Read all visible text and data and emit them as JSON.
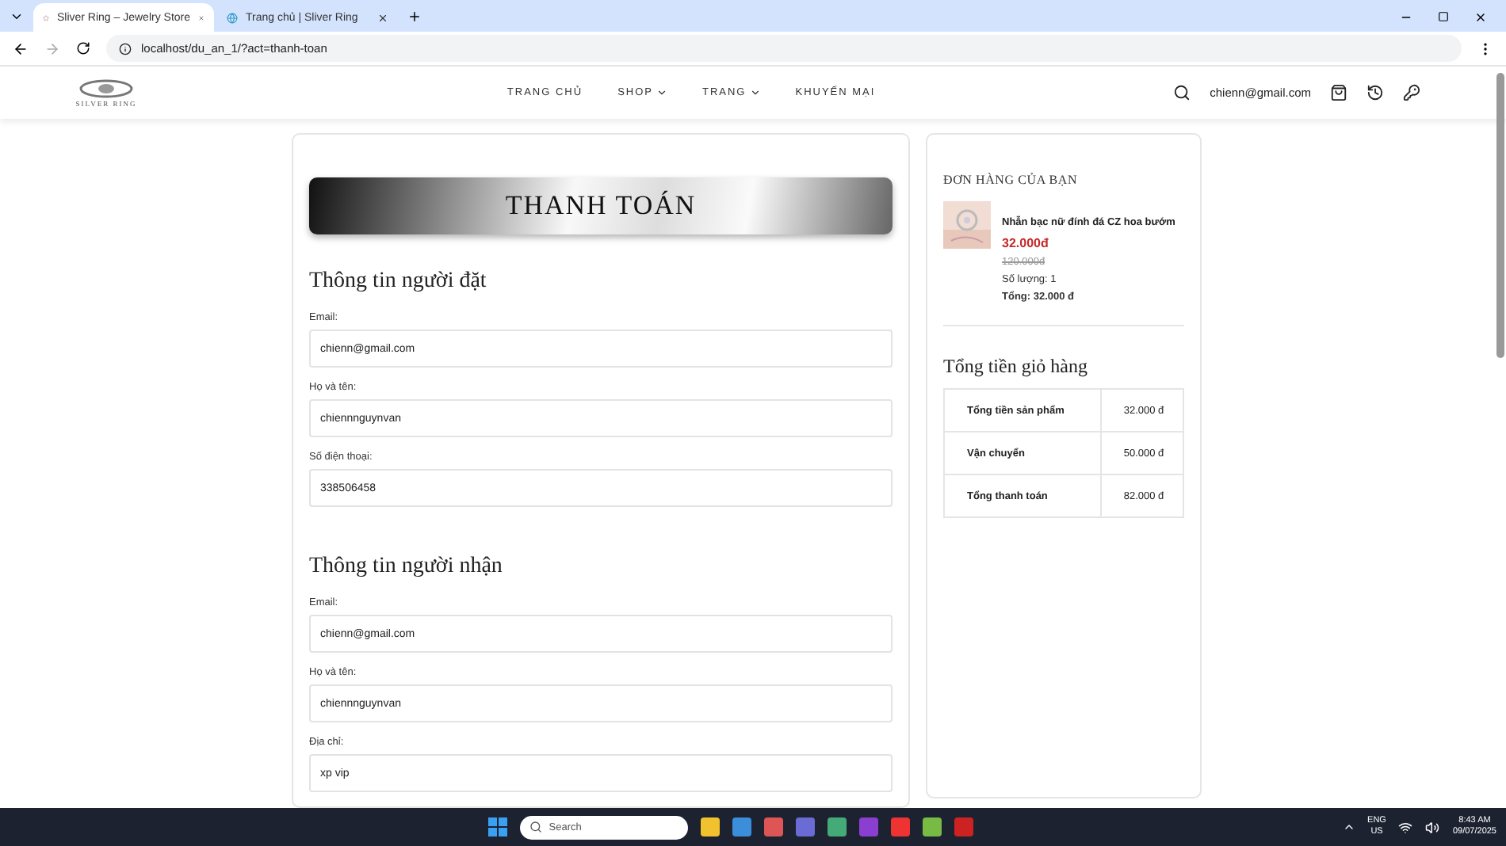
{
  "browser": {
    "tabs": [
      {
        "title": "Sliver Ring – Jewelry Store",
        "selected": true
      },
      {
        "title": "Trang chủ | Sliver Ring",
        "selected": false
      }
    ],
    "url": "localhost/du_an_1/?act=thanh-toan"
  },
  "header": {
    "logo_text": "SILVER RING",
    "nav": [
      {
        "label": "TRANG CHỦ",
        "dropdown": false
      },
      {
        "label": "SHOP",
        "dropdown": true
      },
      {
        "label": "TRANG",
        "dropdown": true
      },
      {
        "label": "KHUYẾN MẠI",
        "dropdown": false
      }
    ],
    "user": "chienn@gmail.com"
  },
  "checkout": {
    "banner": "THANH TOÁN",
    "sections": [
      {
        "title": "Thông tin người đặt",
        "fields": [
          {
            "label": "Email:",
            "value": "chienn@gmail.com"
          },
          {
            "label": "Họ và tên:",
            "value": "chiennnguynvan"
          },
          {
            "label": "Số điện thoại:",
            "value": "338506458"
          }
        ]
      },
      {
        "title": "Thông tin người nhận",
        "fields": [
          {
            "label": "Email:",
            "value": "chienn@gmail.com"
          },
          {
            "label": "Họ và tên:",
            "value": "chiennnguynvan"
          },
          {
            "label": "Địa chỉ:",
            "value": "xp vip"
          }
        ]
      }
    ]
  },
  "order": {
    "title": "ĐƠN HÀNG CỦA BẠN",
    "items": [
      {
        "name": "Nhẫn bạc nữ đính đá CZ hoa bướm",
        "price": "32.000đ",
        "old_price": "120.000đ",
        "quantity": "Số lượng: 1",
        "total": "Tổng: 32.000 đ"
      }
    ],
    "totals_title": "Tổng tiền giỏ hàng",
    "totals": [
      {
        "label": "Tổng tiền sản phẩm",
        "value": "32.000 đ"
      },
      {
        "label": "Vận chuyển",
        "value": "50.000 đ"
      },
      {
        "label": "Tổng thanh toán",
        "value": "82.000 đ"
      }
    ]
  },
  "taskbar": {
    "search_placeholder": "Search",
    "language": "ENG",
    "region": "US",
    "time": "8:43 AM",
    "date": "09/07/2025"
  }
}
